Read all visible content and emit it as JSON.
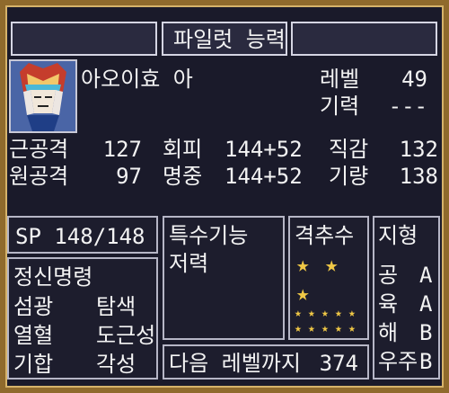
{
  "header": {
    "title": "파일럿 능력",
    "left_blank": "",
    "right_blank": ""
  },
  "pilot": {
    "name": "아오이효 아",
    "level_label": "레벨",
    "level_value": "49",
    "morale_label": "기력",
    "morale_value": "---"
  },
  "stats": [
    {
      "label": "근공격",
      "value": "127"
    },
    {
      "label": "원공격",
      "value": "97"
    },
    {
      "label": "회피",
      "value": "144+52"
    },
    {
      "label": "명중",
      "value": "144+52"
    },
    {
      "label": "직감",
      "value": "132"
    },
    {
      "label": "기량",
      "value": "138"
    }
  ],
  "sp": {
    "text": "SP 148/148"
  },
  "special_skill": {
    "title": "특수기능",
    "value": "저력"
  },
  "shootdowns": {
    "title": "격추수",
    "star_rows": {
      "large": 3,
      "small": 10
    }
  },
  "terrain": {
    "title": "지형",
    "items": [
      {
        "label": "공",
        "value": "A"
      },
      {
        "label": "육",
        "value": "A"
      },
      {
        "label": "해",
        "value": "B"
      },
      {
        "label": "우주",
        "value": "B"
      }
    ]
  },
  "spirit": {
    "title": "정신명령",
    "commands": [
      [
        "섬광",
        "탐색"
      ],
      [
        "열혈",
        "도근성"
      ],
      [
        "기합",
        "각성"
      ]
    ]
  },
  "next_level": {
    "label": "다음 레벨까지",
    "value": "374"
  },
  "colors": {
    "gold_frame": "#8f6a2c",
    "star": "#f0c846"
  }
}
